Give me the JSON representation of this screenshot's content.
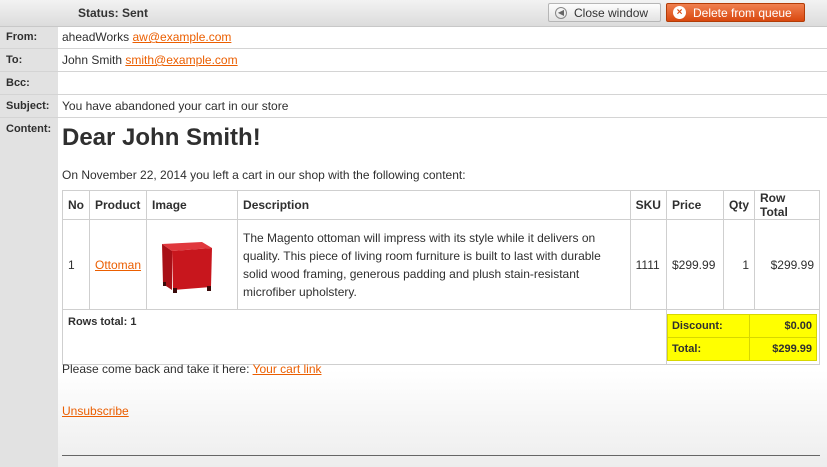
{
  "toolbar": {
    "status": "Status: Sent",
    "close_label": "Close window",
    "delete_label": "Delete from queue"
  },
  "header": {
    "from_label": "From:",
    "from_name": "aheadWorks",
    "from_email": "aw@example.com",
    "to_label": "To:",
    "to_name": "John Smith",
    "to_email": "smith@example.com",
    "bcc_label": "Bcc:",
    "bcc_value": "",
    "subject_label": "Subject:",
    "subject_value": "You have abandoned your cart in our store",
    "content_label": "Content:"
  },
  "email": {
    "greeting": "Dear John Smith!",
    "intro": "On November 22, 2014 you left a cart in our shop with the following content:",
    "come_back_text": "Please come back and take it here:",
    "cart_link": "Your cart link",
    "unsubscribe": "Unsubscribe"
  },
  "cart": {
    "columns": [
      "No",
      "Product",
      "Image",
      "Description",
      "SKU",
      "Price",
      "Qty",
      "Row Total"
    ],
    "rows": [
      {
        "no": "1",
        "product": "Ottoman",
        "image": "red-ottoman-image",
        "description": "The Magento ottoman will impress with its style while it delivers on quality. This piece of living room furniture is built to last with durable solid wood framing, generous padding and plush stain-resistant microfiber upholstery.",
        "sku": "1111",
        "price": "$299.99",
        "qty": "1",
        "row_total": "$299.99"
      }
    ],
    "rows_total": "Rows total: 1",
    "discount_label": "Discount:",
    "discount_value": "$0.00",
    "total_label": "Total:",
    "total_value": "$299.99"
  },
  "colors": {
    "link": "#eb5e00",
    "delete_button": "#d9480f",
    "totals_highlight": "#ffff00",
    "ottoman": "#c8161d"
  }
}
